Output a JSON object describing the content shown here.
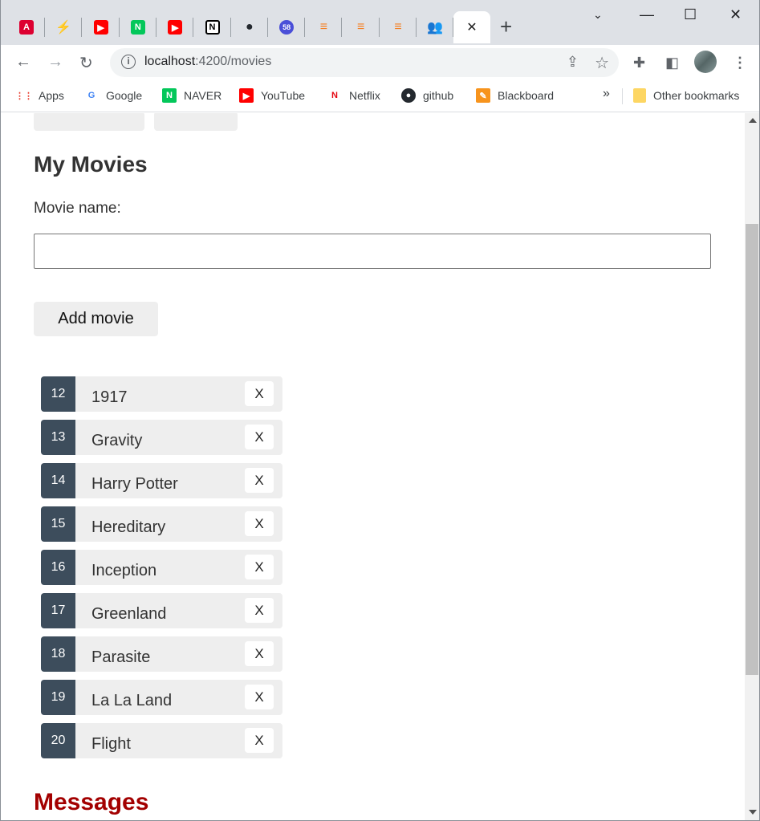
{
  "browser": {
    "tabs": [
      {
        "icon": "angular-icon",
        "glyph": "A",
        "color": "#dd0031"
      },
      {
        "icon": "bolt-icon",
        "glyph": "⚡",
        "color": "#1a73e8"
      },
      {
        "icon": "youtube-icon",
        "glyph": "▶",
        "color": "#ff0000"
      },
      {
        "icon": "naver-icon",
        "glyph": "N",
        "color": "#03c75a"
      },
      {
        "icon": "youtube-icon",
        "glyph": "▶",
        "color": "#ff0000"
      },
      {
        "icon": "notion-icon",
        "glyph": "N",
        "color": "#000000"
      },
      {
        "icon": "github-icon",
        "glyph": "●",
        "color": "#24292f"
      },
      {
        "icon": "notification-icon",
        "glyph": "58",
        "color": "#4a4fd8"
      },
      {
        "icon": "stackoverflow-icon",
        "glyph": "≡",
        "color": "#f48024"
      },
      {
        "icon": "stackoverflow-icon",
        "glyph": "≡",
        "color": "#f48024"
      },
      {
        "icon": "stackoverflow-icon",
        "glyph": "≡",
        "color": "#f48024"
      },
      {
        "icon": "people-icon",
        "glyph": "👥",
        "color": "#4285f4"
      }
    ],
    "active_tab_close": "✕",
    "new_tab": "+",
    "url_host": "localhost",
    "url_path": ":4200/movies"
  },
  "bookmarks": [
    {
      "label": "Apps",
      "icon": "apps-grid-icon"
    },
    {
      "label": "Google",
      "icon": "google-icon"
    },
    {
      "label": "NAVER",
      "icon": "naver-icon"
    },
    {
      "label": "YouTube",
      "icon": "youtube-icon"
    },
    {
      "label": "Netflix",
      "icon": "netflix-icon"
    },
    {
      "label": "github",
      "icon": "github-icon"
    },
    {
      "label": "Blackboard",
      "icon": "blackboard-icon"
    }
  ],
  "bookmarks_more": "»",
  "other_bookmarks": "Other bookmarks",
  "page": {
    "title": "My Movies",
    "input_label": "Movie name:",
    "input_value": "",
    "add_button": "Add movie",
    "delete_label": "X",
    "movies": [
      {
        "id": "12",
        "name": "1917"
      },
      {
        "id": "13",
        "name": "Gravity"
      },
      {
        "id": "14",
        "name": "Harry Potter"
      },
      {
        "id": "15",
        "name": "Hereditary"
      },
      {
        "id": "16",
        "name": "Inception"
      },
      {
        "id": "17",
        "name": "Greenland"
      },
      {
        "id": "18",
        "name": "Parasite"
      },
      {
        "id": "19",
        "name": "La La Land"
      },
      {
        "id": "20",
        "name": "Flight"
      }
    ],
    "messages_heading": "Messages"
  }
}
